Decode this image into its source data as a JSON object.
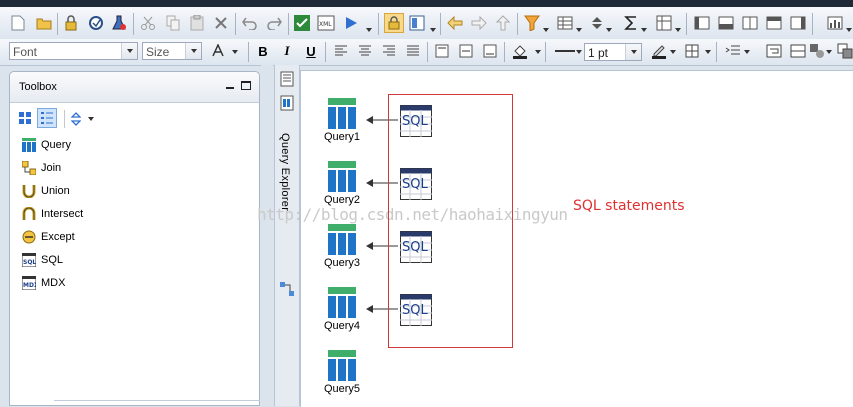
{
  "format_bar": {
    "font_placeholder": "Font",
    "size_placeholder": "Size",
    "pen_width": "1 pt"
  },
  "toolbox": {
    "title": "Toolbox",
    "items": [
      {
        "label": "Query",
        "icon": "query-icon"
      },
      {
        "label": "Join",
        "icon": "join-icon"
      },
      {
        "label": "Union",
        "icon": "union-icon"
      },
      {
        "label": "Intersect",
        "icon": "intersect-icon"
      },
      {
        "label": "Except",
        "icon": "except-icon"
      },
      {
        "label": "SQL",
        "icon": "sql-icon"
      },
      {
        "label": "MDX",
        "icon": "mdx-icon"
      }
    ]
  },
  "side_panel": {
    "tab_label": "Query Explorer"
  },
  "canvas": {
    "queries": [
      {
        "label": "Query1"
      },
      {
        "label": "Query2"
      },
      {
        "label": "Query3"
      },
      {
        "label": "Query4"
      },
      {
        "label": "Query5"
      }
    ],
    "sql_icon_text": "SQL",
    "annotation": "SQL statements",
    "watermark": "http://blog.csdn.net/haohaixingyun"
  },
  "colors": {
    "annotation": "#e03030",
    "query_icon": "#1f74c7",
    "query_icon_top": "#3fae6b"
  }
}
